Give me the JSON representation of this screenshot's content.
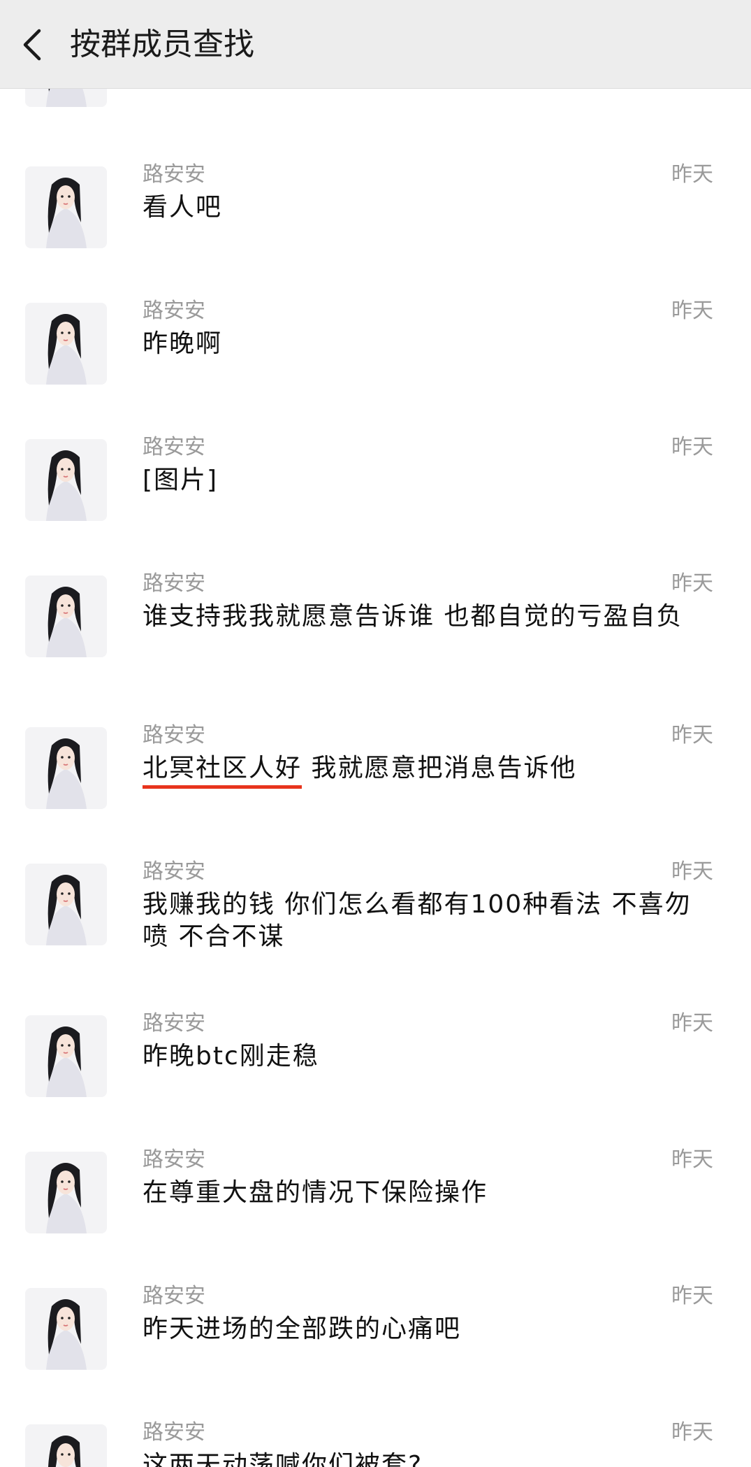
{
  "header": {
    "title": "按群成员查找",
    "back_icon": "chevron-left-icon"
  },
  "messages": [
    {
      "sender": "路安安",
      "time": "昨天",
      "text": "看人吧",
      "highlight": ""
    },
    {
      "sender": "路安安",
      "time": "昨天",
      "text": "昨晚啊",
      "highlight": ""
    },
    {
      "sender": "路安安",
      "time": "昨天",
      "text": "[图片]",
      "highlight": ""
    },
    {
      "sender": "路安安",
      "time": "昨天",
      "text": "谁支持我我就愿意告诉谁 也都自觉的亏盈自负",
      "highlight": ""
    },
    {
      "sender": "路安安",
      "time": "昨天",
      "text": " 我就愿意把消息告诉他",
      "highlight": "北冥社区人好"
    },
    {
      "sender": "路安安",
      "time": "昨天",
      "text": "我赚我的钱 你们怎么看都有100种看法  不喜勿喷 不合不谋",
      "highlight": ""
    },
    {
      "sender": "路安安",
      "time": "昨天",
      "text": "昨晚btc刚走稳",
      "highlight": ""
    },
    {
      "sender": "路安安",
      "time": "昨天",
      "text": "在尊重大盘的情况下保险操作",
      "highlight": ""
    },
    {
      "sender": "路安安",
      "time": "昨天",
      "text": "昨天进场的全部跌的心痛吧",
      "highlight": ""
    },
    {
      "sender": "路安安",
      "time": "昨天",
      "text": "这两天动荡喊你们被套?",
      "highlight": ""
    }
  ],
  "colors": {
    "underline": "#e8341c",
    "header_bg": "#ededed",
    "meta_text": "#9a9a9a"
  }
}
